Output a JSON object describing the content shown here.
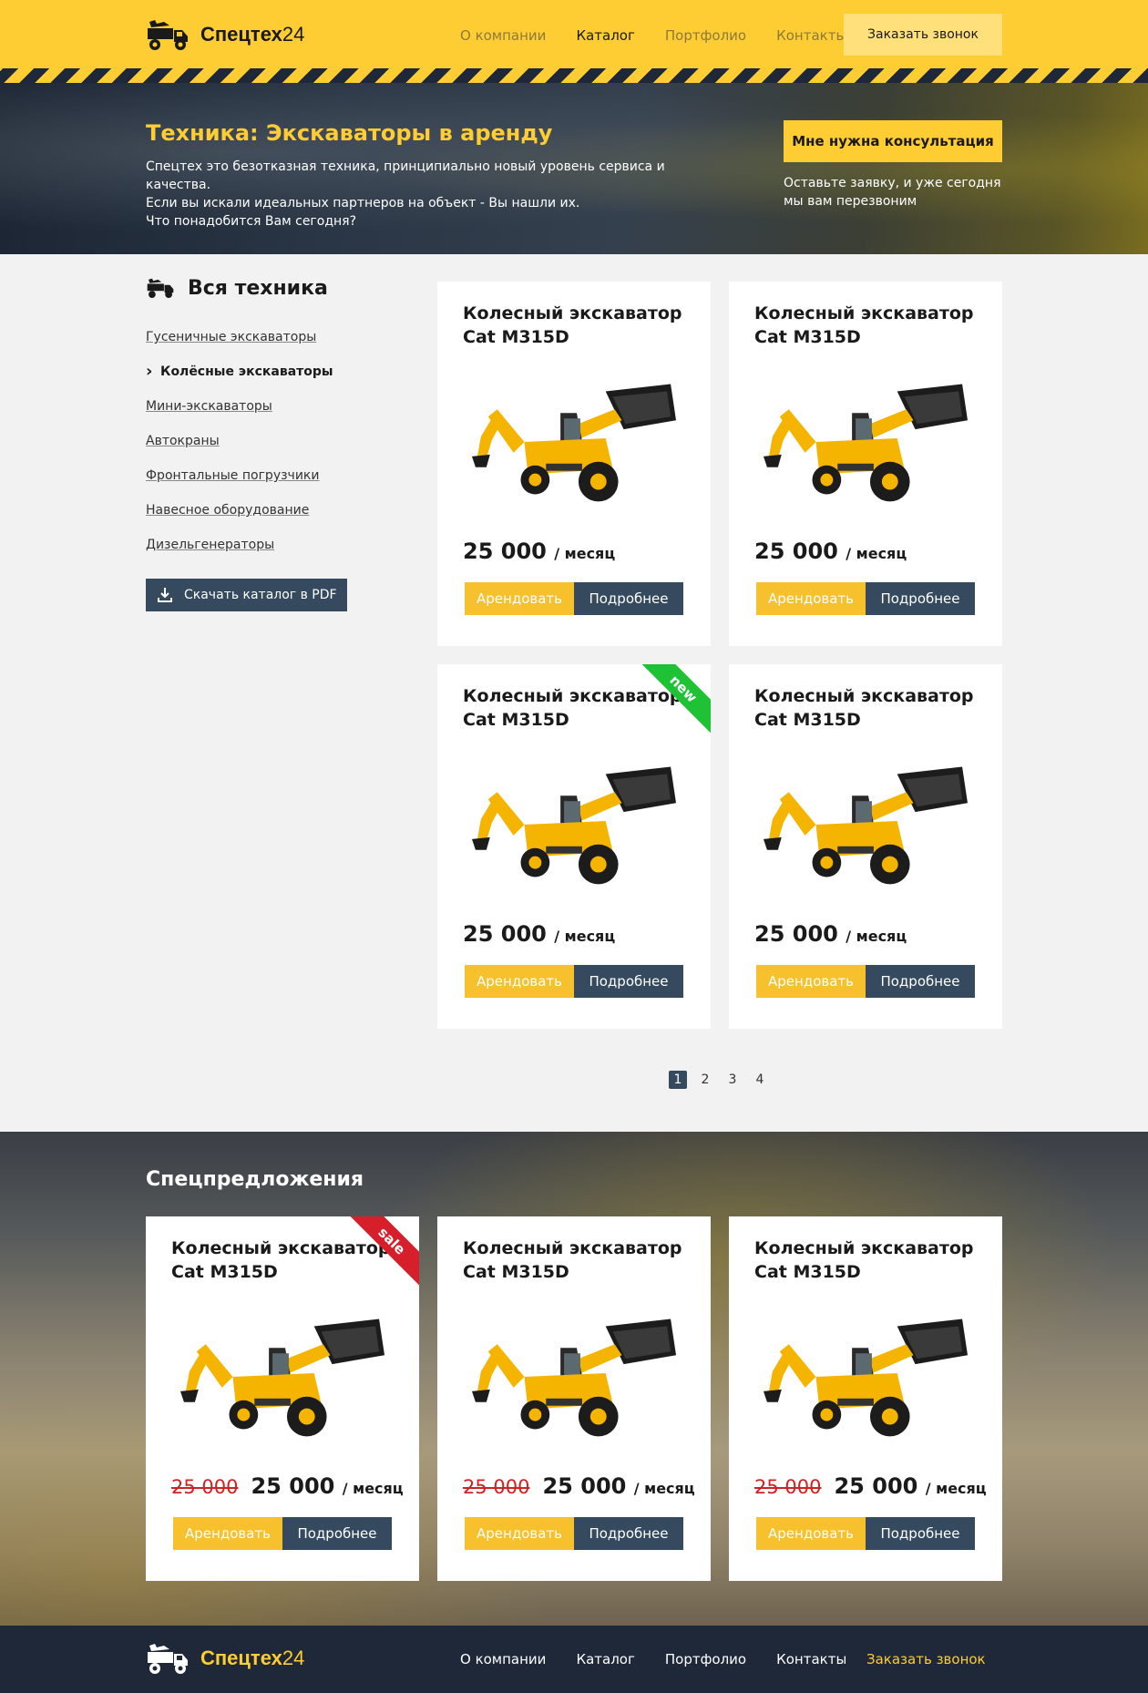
{
  "brand": {
    "name": "Спецтех",
    "suffix": "24"
  },
  "nav": {
    "items": [
      "О компании",
      "Каталог",
      "Портфолио",
      "Контакты"
    ],
    "active": "Каталог",
    "call_label": "Заказать звонок"
  },
  "hero": {
    "title": "Техника: Экскаваторы в аренду",
    "lines": [
      "Спецтех это безотказная техника, принципиально новый уровень сервиса и качества.",
      "Если вы искали идеальных партнеров на объект - Вы нашли их.",
      "Что понадобится Вам сегодня?"
    ],
    "cta": "Мне нужна консультация",
    "note_lines": [
      "Оставьте заявку, и уже сегодня",
      "мы вам перезвоним"
    ]
  },
  "sidebar": {
    "title": "Вся техника",
    "items": [
      "Гусеничные экскаваторы",
      "Колёсные экскаваторы",
      "Мини-экскаваторы",
      "Автокраны",
      "Фронтальные погрузчики",
      "Навесное оборудование",
      "Дизельгенераторы"
    ],
    "active_index": 1,
    "pdf_label": "Скачать каталог в PDF"
  },
  "catalog": [
    {
      "title1": "Колесный экскаватор",
      "title2": "Cat M315D",
      "price": "25 000",
      "unit": "/ месяц",
      "rent": "Арендовать",
      "more": "Подробнее",
      "badge": ""
    },
    {
      "title1": "Колесный экскаватор",
      "title2": "Cat M315D",
      "price": "25 000",
      "unit": "/ месяц",
      "rent": "Арендовать",
      "more": "Подробнее",
      "badge": ""
    },
    {
      "title1": "Колесный экскаватор",
      "title2": "Cat M315D",
      "price": "25 000",
      "unit": "/ месяц",
      "rent": "Арендовать",
      "more": "Подробнее",
      "badge": "new"
    },
    {
      "title1": "Колесный экскаватор",
      "title2": "Cat M315D",
      "price": "25 000",
      "unit": "/ месяц",
      "rent": "Арендовать",
      "more": "Подробнее",
      "badge": ""
    }
  ],
  "pagination": {
    "pages": [
      "1",
      "2",
      "3",
      "4"
    ],
    "current": "1"
  },
  "special": {
    "title": "Спецпредложения",
    "items": [
      {
        "title1": "Колесный экскаватор",
        "title2": "Cat M315D",
        "old_price": "25 000",
        "price": "25 000",
        "unit": "/ месяц",
        "rent": "Арендовать",
        "more": "Подробнее",
        "badge": "sale"
      },
      {
        "title1": "Колесный экскаватор",
        "title2": "Cat M315D",
        "old_price": "25 000",
        "price": "25 000",
        "unit": "/ месяц",
        "rent": "Арендовать",
        "more": "Подробнее",
        "badge": ""
      },
      {
        "title1": "Колесный экскаватор",
        "title2": "Cat M315D",
        "old_price": "25 000",
        "price": "25 000",
        "unit": "/ месяц",
        "rent": "Арендовать",
        "more": "Подробнее",
        "badge": ""
      }
    ]
  },
  "footer": {
    "nav": [
      "О компании",
      "Каталог",
      "Портфолио",
      "Контакты"
    ],
    "call_label": "Заказать звонок"
  },
  "colors": {
    "accent": "#fecc33",
    "dark": "#1f2838",
    "button_dark": "#354a5f",
    "new_badge": "#1ec234",
    "sale_badge": "#d61f2a"
  }
}
